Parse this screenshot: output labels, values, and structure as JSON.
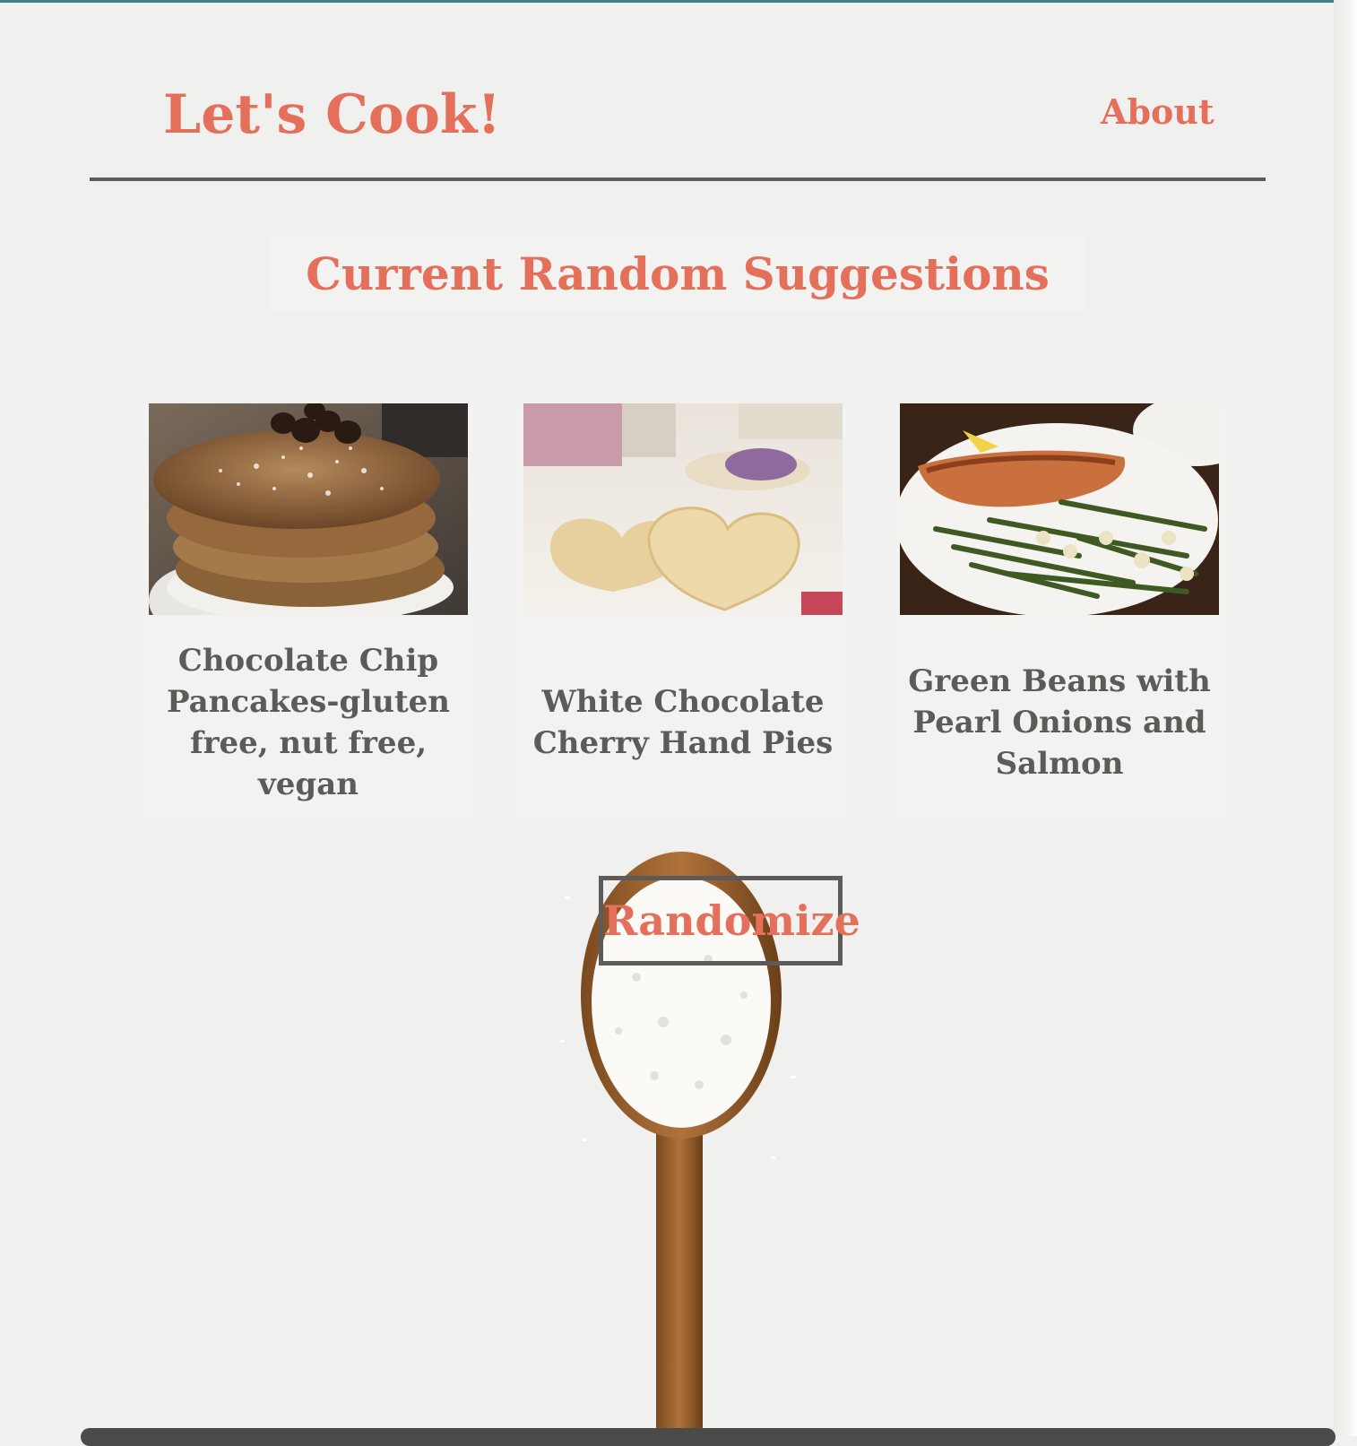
{
  "header": {
    "title": "Let's Cook!",
    "nav_about": "About"
  },
  "section": {
    "title": "Current Random Suggestions"
  },
  "recipes": [
    {
      "name": "Chocolate Chip Pancakes-gluten free, nut free, vegan",
      "image": "pancakes-photo"
    },
    {
      "name": "White Chocolate Cherry Hand Pies",
      "image": "hand-pies-photo"
    },
    {
      "name": "Green Beans with Pearl Onions and Salmon",
      "image": "salmon-green-beans-photo"
    }
  ],
  "actions": {
    "randomize_label": "Randomize"
  },
  "colors": {
    "accent": "#e4705b",
    "text_dark": "#5d5b58",
    "rule": "#5b5a58",
    "background": "#f0f0ee",
    "top_bar": "#3d7f8a"
  }
}
